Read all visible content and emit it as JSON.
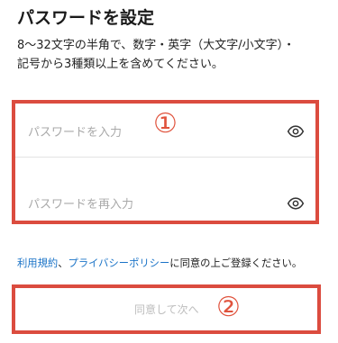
{
  "header": {
    "title": "パスワードを設定",
    "description_line1": "8〜32文字の半角で、数字・英字（大文字/小文字）・",
    "description_line2": "記号から3種類以上を含めてください。"
  },
  "form": {
    "password_placeholder": "パスワードを入力",
    "password_value": "",
    "confirm_placeholder": "パスワードを再入力",
    "confirm_value": "",
    "eye_icon": "eye-icon"
  },
  "annotations": {
    "marker1": "①",
    "marker2": "②",
    "color": "#db4c3f"
  },
  "terms": {
    "terms_link": "利用規約",
    "separator": "、",
    "privacy_link": "プライバシーポリシー",
    "suffix": "に同意の上ご登録ください。",
    "link_color": "#1a73c7"
  },
  "submit": {
    "label": "同意して次へ",
    "enabled": false
  }
}
